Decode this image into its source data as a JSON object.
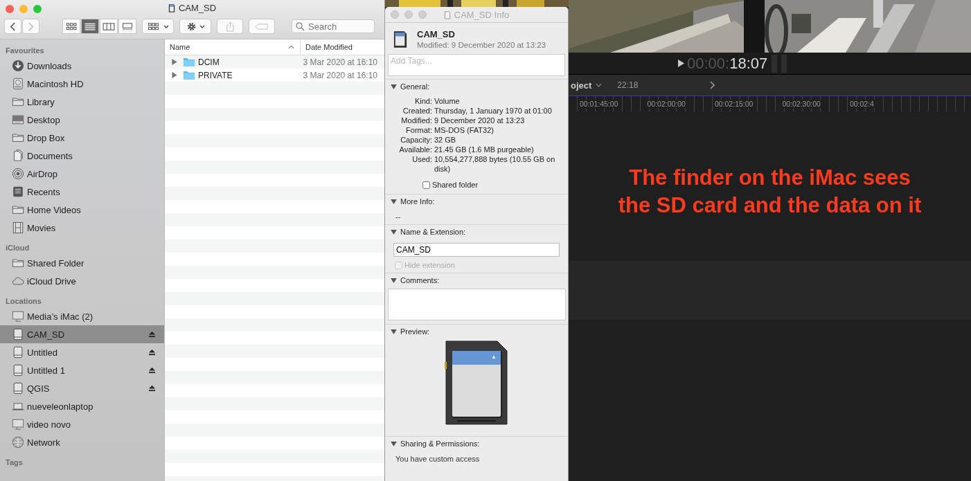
{
  "finder": {
    "title": "CAM_SD",
    "toolbar": {
      "back_disabled": false,
      "forward_disabled": true,
      "views": [
        {
          "kind": "icons",
          "selected": false
        },
        {
          "kind": "list",
          "selected": true
        },
        {
          "kind": "columns",
          "selected": false
        },
        {
          "kind": "gallery",
          "selected": false
        }
      ],
      "search": {
        "placeholder": "Search"
      }
    },
    "sidebar": [
      {
        "heading": "Favourites",
        "items": [
          {
            "label": "Downloads",
            "kind": "download",
            "selected": false,
            "eject": false
          },
          {
            "label": "Macintosh HD",
            "kind": "disk",
            "selected": false,
            "eject": false
          },
          {
            "label": "Library",
            "kind": "folder",
            "selected": false,
            "eject": false
          },
          {
            "label": "Desktop",
            "kind": "desktop",
            "selected": false,
            "eject": false
          },
          {
            "label": "Drop Box",
            "kind": "folder",
            "selected": false,
            "eject": false
          },
          {
            "label": "Documents",
            "kind": "documents",
            "selected": false,
            "eject": false
          },
          {
            "label": "AirDrop",
            "kind": "airdrop",
            "selected": false,
            "eject": false
          },
          {
            "label": "Recents",
            "kind": "recents",
            "selected": false,
            "eject": false
          },
          {
            "label": "Home Videos",
            "kind": "folder",
            "selected": false,
            "eject": false
          },
          {
            "label": "Movies",
            "kind": "film",
            "selected": false,
            "eject": false
          }
        ]
      },
      {
        "heading": "iCloud",
        "items": [
          {
            "label": "Shared Folder",
            "kind": "folder",
            "selected": false,
            "eject": false
          },
          {
            "label": "iCloud Drive",
            "kind": "cloud",
            "selected": false,
            "eject": false
          }
        ]
      },
      {
        "heading": "Locations",
        "items": [
          {
            "label": "Media’s iMac (2)",
            "kind": "monitor",
            "selected": false,
            "eject": false
          },
          {
            "label": "CAM_SD",
            "kind": "drive",
            "selected": true,
            "eject": true
          },
          {
            "label": "Untitled",
            "kind": "drive",
            "selected": false,
            "eject": true
          },
          {
            "label": "Untitled 1",
            "kind": "drive",
            "selected": false,
            "eject": true
          },
          {
            "label": "QGIS",
            "kind": "drive",
            "selected": false,
            "eject": true
          },
          {
            "label": "nueveleonlaptop",
            "kind": "laptop",
            "selected": false,
            "eject": false
          },
          {
            "label": "video novo",
            "kind": "monitor",
            "selected": false,
            "eject": false
          },
          {
            "label": "Network",
            "kind": "globe",
            "selected": false,
            "eject": false
          }
        ]
      },
      {
        "heading": "Tags"
      }
    ],
    "columns": [
      {
        "label": "Name",
        "sorted": true
      },
      {
        "label": "Date Modified",
        "sorted": false
      }
    ],
    "rows": [
      {
        "name": "DCIM",
        "date": "3 Mar 2020 at 16:10",
        "expanded": false
      },
      {
        "name": "PRIVATE",
        "date": "3 Mar 2020 at 16:10",
        "expanded": false
      }
    ]
  },
  "info": {
    "title": "CAM_SD Info",
    "name": "CAM_SD",
    "modified": "Modified: 9 December 2020 at 13:23",
    "tags_placeholder": "Add Tags...",
    "sections": [
      {
        "kind": "general",
        "title": "General:",
        "expanded": true,
        "fields": [
          {
            "label": "Kind:",
            "value": "Volume"
          },
          {
            "label": "Created:",
            "value": "Thursday, 1 January 1970 at 01:00"
          },
          {
            "label": "Modified:",
            "value": "9 December 2020 at 13:23"
          },
          {
            "label": "Format:",
            "value": "MS-DOS (FAT32)"
          },
          {
            "label": "Capacity:",
            "value": "32 GB"
          },
          {
            "label": "Available:",
            "value": "21.45 GB (1.6 MB purgeable)"
          },
          {
            "label": "Used:",
            "value": "10,554,277,888 bytes (10.55 GB on disk)"
          }
        ],
        "checkbox": {
          "label": "Shared folder",
          "checked": false,
          "disabled": false
        }
      },
      {
        "kind": "text",
        "title": "More Info:",
        "expanded": true,
        "text": "--"
      },
      {
        "kind": "name",
        "title": "Name & Extension:",
        "expanded": true,
        "value": "CAM_SD",
        "checkbox": {
          "label": "Hide extension",
          "checked": false,
          "disabled": true
        }
      },
      {
        "kind": "comments",
        "title": "Comments:",
        "expanded": true
      },
      {
        "kind": "preview",
        "title": "Preview:",
        "expanded": true
      },
      {
        "kind": "text",
        "title": "Sharing & Permissions:",
        "expanded": true,
        "text": "You have custom access"
      }
    ]
  },
  "editor": {
    "timecode_dim": "00:00:",
    "timecode": "18:07",
    "project": "oject",
    "duration": "22:18",
    "ruler": [
      "00:01:45:00",
      "00:02:00:00",
      "00:02:15:00",
      "00:02:30:00",
      "00:02:4"
    ],
    "annotation": [
      "The finder on the iMac sees",
      "the SD card and the data on it"
    ]
  }
}
